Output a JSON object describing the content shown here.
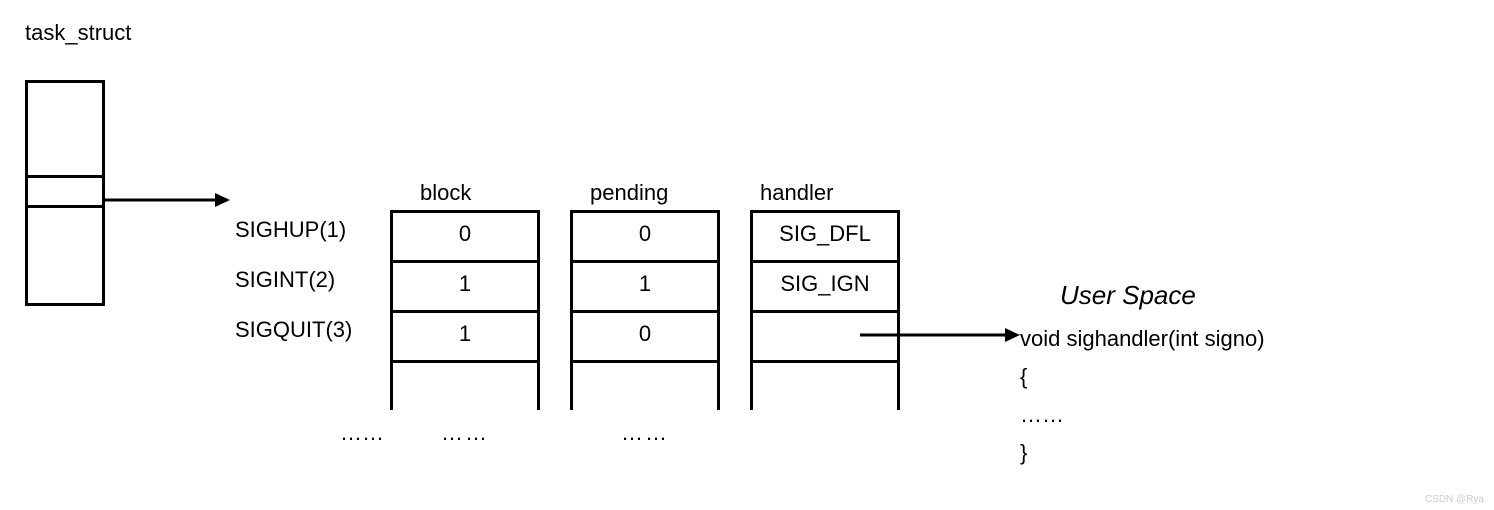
{
  "title": "task_struct",
  "signals": {
    "rows": [
      {
        "name": "SIGHUP(1)",
        "block": "0",
        "pending": "0",
        "handler": "SIG_DFL"
      },
      {
        "name": "SIGINT(2)",
        "block": "1",
        "pending": "1",
        "handler": "SIG_IGN"
      },
      {
        "name": "SIGQUIT(3)",
        "block": "1",
        "pending": "0",
        "handler": ""
      }
    ],
    "ellipsis": "……"
  },
  "columns": {
    "block": "block",
    "pending": "pending",
    "handler": "handler"
  },
  "user_space": {
    "title": "User Space",
    "code_line1": "void sighandler(int signo)",
    "code_line2": "{",
    "code_line3": "……",
    "code_line4": "}"
  },
  "watermark": "CSDN @Rya"
}
